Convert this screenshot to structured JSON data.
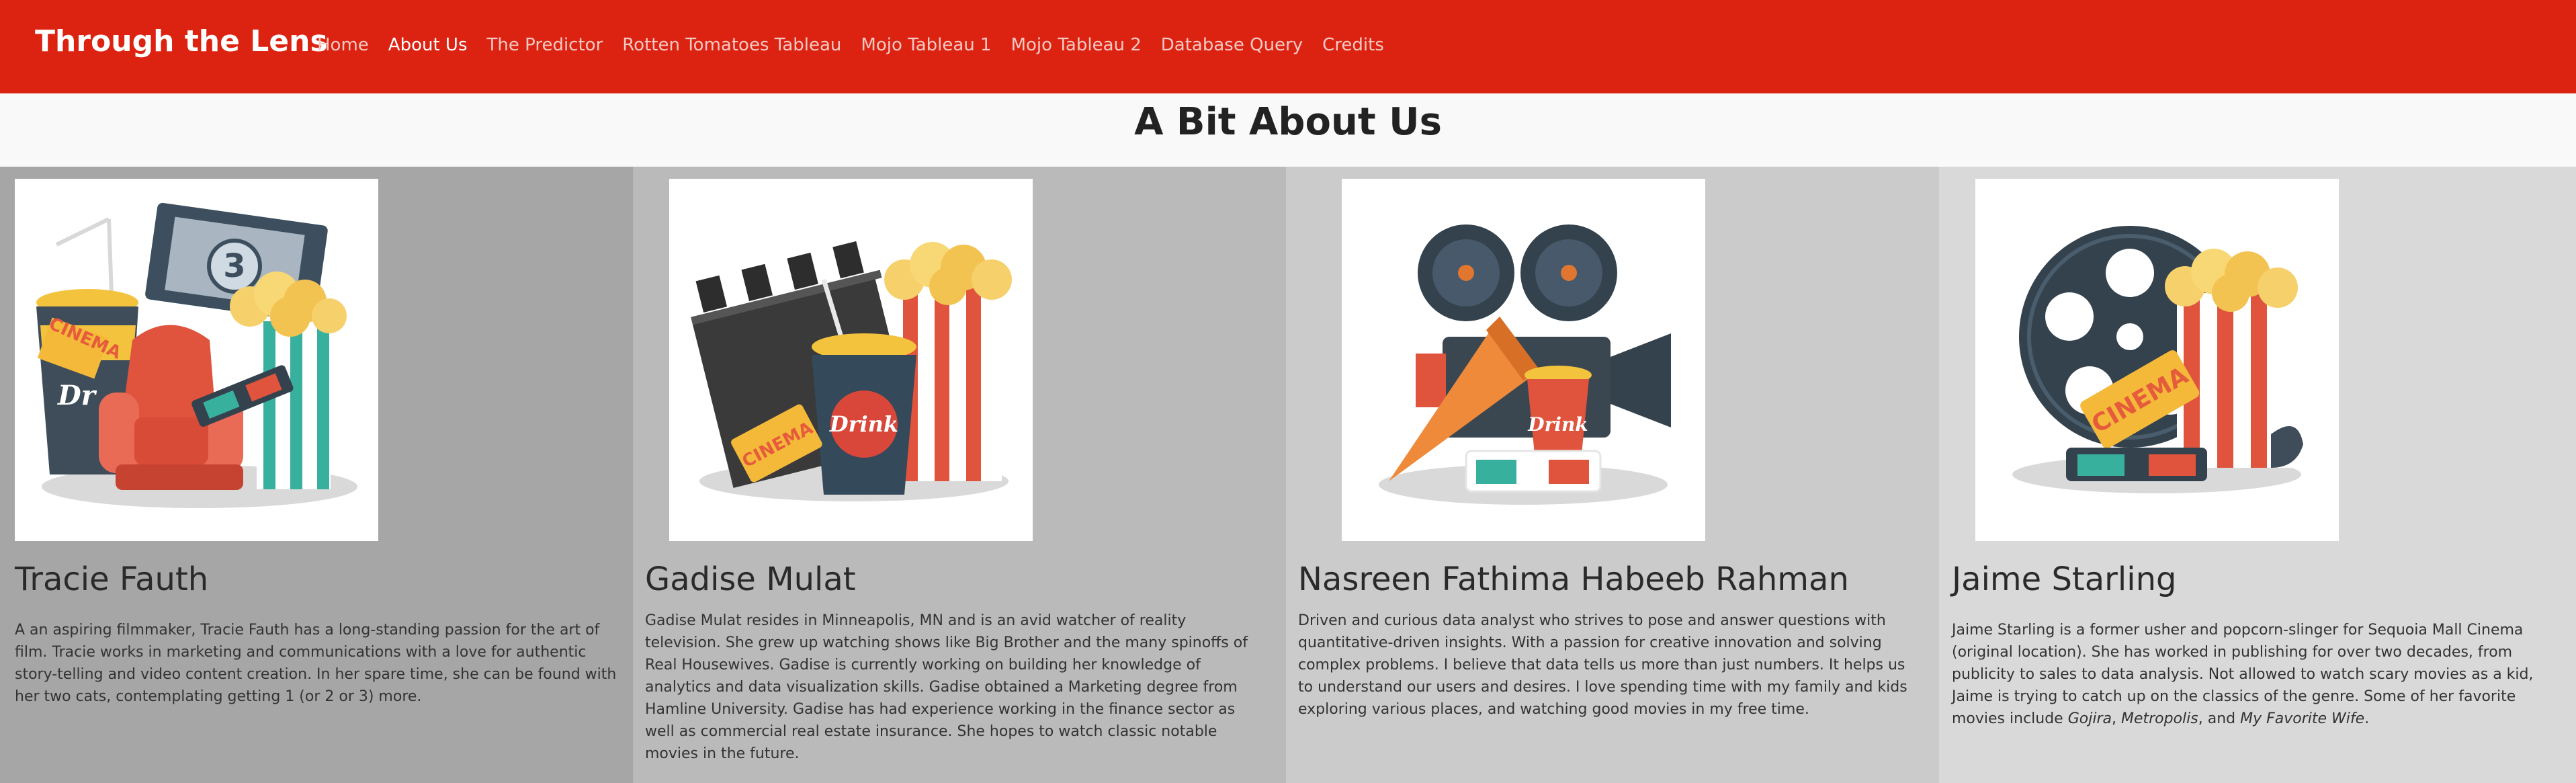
{
  "navbar": {
    "brand": "Through the Lens",
    "links": [
      "Home",
      "About Us",
      "The Predictor",
      "Rotten Tomatoes Tableau",
      "Mojo Tableau 1",
      "Mojo Tableau 2",
      "Database Query",
      "Credits"
    ],
    "active": "About Us",
    "color": "#dc2312"
  },
  "page": {
    "title": "A Bit About Us"
  },
  "members": [
    {
      "name": "Tracie Fauth",
      "bio": "A an aspiring filmmaker, Tracie Fauth has a long-standing passion for the art of film. Tracie works in marketing and communications with a love for authentic story-telling and video content creation. In her spare time, she can be found with her two cats, contemplating getting 1 (or 2 or 3) more.",
      "image": "cinema-chair-popcorn-illustration",
      "ticket_text": "CINEMA",
      "cup_text": "Dr"
    },
    {
      "name": "Gadise Mulat",
      "bio": "Gadise Mulat resides in Minneapolis, MN and is an avid watcher of reality television. She grew up watching shows like Big Brother and the many spinoffs of Real Housewives. Gadise is currently working on building her knowledge of analytics and data visualization skills. Gadise obtained a Marketing degree from Hamline University. Gadise has had experience working in the finance sector as well as commercial real estate insurance. She hopes to watch classic notable movies in the future.",
      "image": "clapperboard-drink-popcorn-illustration",
      "ticket_text": "CINEMA",
      "cup_text": "Drink"
    },
    {
      "name": "Nasreen Fathima Habeeb Rahman",
      "bio": "Driven and curious data analyst who strives to pose and answer questions with quantitative-driven insights. With a passion for creative innovation and solving complex problems. I believe that data tells us more than just numbers. It helps us to understand our users and desires. I love spending time with my family and kids exploring various places, and watching good movies in my free time.",
      "image": "film-camera-megaphone-illustration",
      "cup_text": "Drink"
    },
    {
      "name": "Jaime Starling",
      "bio_pre": "Jaime Starling is a former usher and popcorn-slinger for Sequoia Mall Cinema (original location). She has worked in publishing for over two decades, from publicity to sales to data analysis. Not allowed to watch scary movies as a kid, Jaime is trying to catch up on the classics of the genre. Some of her favorite movies include ",
      "bio_movie1": "Gojira",
      "bio_sep1": ", ",
      "bio_movie2": "Metropolis",
      "bio_sep2": ", and ",
      "bio_movie3": "My Favorite Wife",
      "bio_end": ".",
      "image": "film-reel-popcorn-illustration",
      "ticket_text": "CINEMA"
    }
  ]
}
